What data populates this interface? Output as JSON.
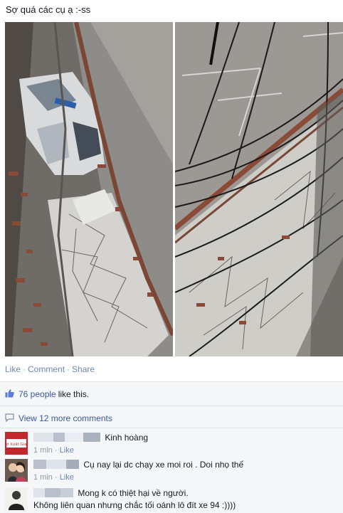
{
  "post": {
    "caption": "Sợ quá các cụ ạ :-ss"
  },
  "actions": {
    "like": "Like",
    "comment": "Comment",
    "share": "Share"
  },
  "likes": {
    "count_label": "76 people",
    "suffix": "like this."
  },
  "comments_link": "View 12 more comments",
  "comments": [
    {
      "text": "Kinh hoàng",
      "time": "1 min",
      "like": "Like",
      "avatar_label": "Chợ Xuất Giang"
    },
    {
      "text": "Cụ nay lại dc chạy xe moi roi . Doi nhọ thế",
      "time": "1 min",
      "like": "Like"
    },
    {
      "text": "Mong k có thiệt hại về người.",
      "text2": "Không liên quan nhưng chắc tối oánh lô đít xe 94 :))))"
    }
  ],
  "icons": {
    "thumb": "thumbs-up-icon",
    "comment": "comment-bubble-icon"
  }
}
